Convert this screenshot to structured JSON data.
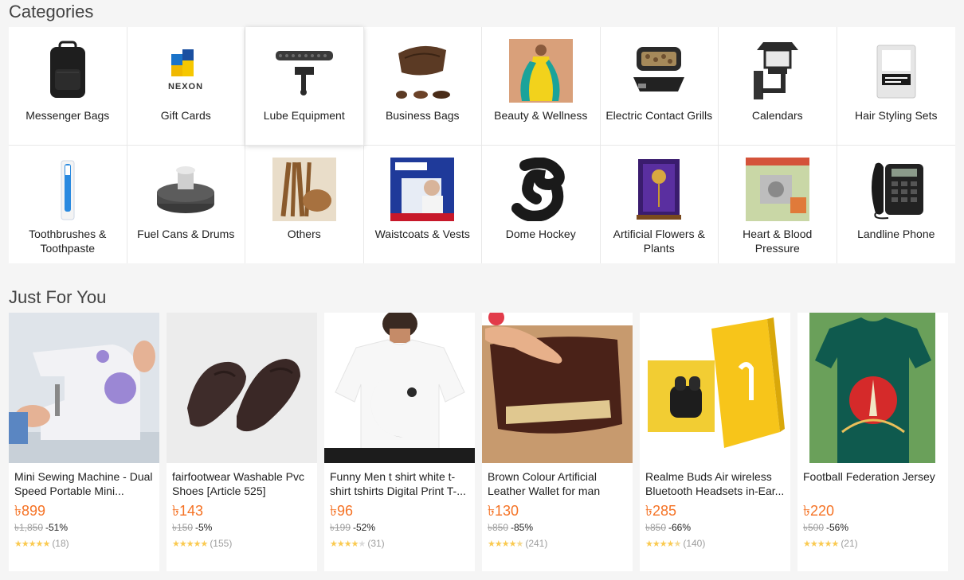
{
  "categories": {
    "title": "Categories",
    "items": [
      {
        "label": "Messenger Bags",
        "icon": "backpack-image"
      },
      {
        "label": "Gift Cards",
        "icon": "nexon-logo-image"
      },
      {
        "label": "Lube Equipment",
        "icon": "chain-tool-image"
      },
      {
        "label": "Business Bags",
        "icon": "waist-bag-image"
      },
      {
        "label": "Beauty & Wellness",
        "icon": "dress-model-image"
      },
      {
        "label": "Electric Contact Grills",
        "icon": "grill-image"
      },
      {
        "label": "Calendars",
        "icon": "wall-lamp-image"
      },
      {
        "label": "Hair Styling Sets",
        "icon": "hair-pack-image"
      },
      {
        "label": "Toothbrushes & Toothpaste",
        "icon": "toothbrush-image"
      },
      {
        "label": "Fuel Cans & Drums",
        "icon": "round-stand-image"
      },
      {
        "label": "Others",
        "icon": "wooden-sticks-image"
      },
      {
        "label": "Waistcoats & Vests",
        "icon": "vest-pack-image"
      },
      {
        "label": "Dome Hockey",
        "icon": "skate-guard-image"
      },
      {
        "label": "Artificial Flowers & Plants",
        "icon": "gold-rose-box-image"
      },
      {
        "label": "Heart & Blood Pressure",
        "icon": "carburetor-image"
      },
      {
        "label": "Landline Phone",
        "icon": "desk-phone-image"
      }
    ]
  },
  "just_for_you": {
    "title": "Just For You",
    "products": [
      {
        "title": "Mini Sewing Machine - Dual Speed Portable Mini...",
        "price": "৳899",
        "original_price": "৳1,850",
        "discount": "-51%",
        "rating": 5,
        "reviews": "(18)",
        "image": "sewing-machine-image"
      },
      {
        "title": "fairfootwear Washable Pvc Shoes [Article 525]",
        "price": "৳143",
        "original_price": "৳150",
        "discount": "-5%",
        "rating": 5,
        "reviews": "(155)",
        "image": "brown-shoes-image"
      },
      {
        "title": "Funny Men t shirt white t-shirt tshirts Digital Print T-...",
        "price": "৳96",
        "original_price": "৳199",
        "discount": "-52%",
        "rating": 4,
        "reviews": "(31)",
        "image": "tshirt-image"
      },
      {
        "title": "Brown Colour Artificial Leather Wallet for man",
        "price": "৳130",
        "original_price": "৳850",
        "discount": "-85%",
        "rating": 4.5,
        "reviews": "(241)",
        "image": "wallet-image"
      },
      {
        "title": "Realme Buds Air wireless Bluetooth Headsets in-Ear...",
        "price": "৳285",
        "original_price": "৳850",
        "discount": "-66%",
        "rating": 4.5,
        "reviews": "(140)",
        "image": "earbuds-image"
      },
      {
        "title": "Football Federation Jersey",
        "price": "৳220",
        "original_price": "৳500",
        "discount": "-56%",
        "rating": 5,
        "reviews": "(21)",
        "image": "jersey-image"
      }
    ]
  },
  "colors": {
    "price": "#f57224",
    "star": "#faca51",
    "background": "#f5f5f5"
  }
}
